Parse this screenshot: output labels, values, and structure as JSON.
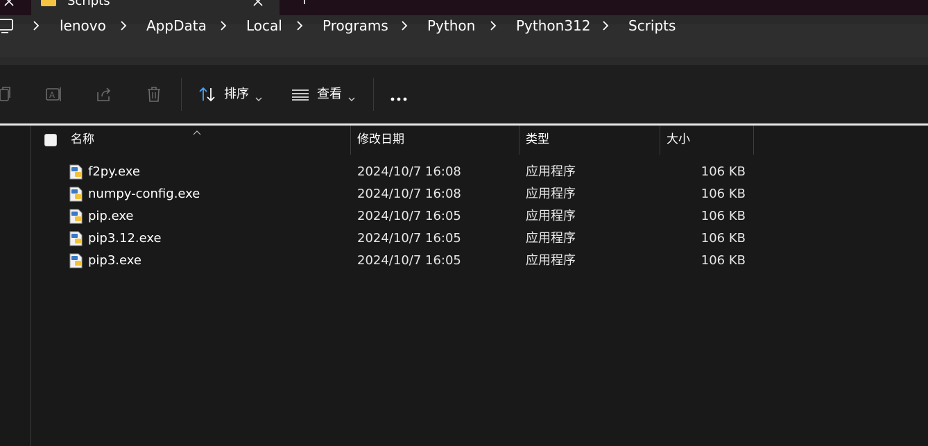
{
  "tabs": [
    {
      "title": "Scripts",
      "active": true
    }
  ],
  "breadcrumb": [
    "lenovo",
    "AppData",
    "Local",
    "Programs",
    "Python",
    "Python312",
    "Scripts"
  ],
  "toolbar": {
    "sort_label": "排序",
    "view_label": "查看"
  },
  "columns": [
    "名称",
    "修改日期",
    "类型",
    "大小"
  ],
  "files": [
    {
      "name": "f2py.exe",
      "modified": "2024/10/7 16:08",
      "type": "应用程序",
      "size": "106 KB"
    },
    {
      "name": "numpy-config.exe",
      "modified": "2024/10/7 16:08",
      "type": "应用程序",
      "size": "106 KB"
    },
    {
      "name": "pip.exe",
      "modified": "2024/10/7 16:05",
      "type": "应用程序",
      "size": "106 KB"
    },
    {
      "name": "pip3.12.exe",
      "modified": "2024/10/7 16:05",
      "type": "应用程序",
      "size": "106 KB"
    },
    {
      "name": "pip3.exe",
      "modified": "2024/10/7 16:05",
      "type": "应用程序",
      "size": "106 KB"
    }
  ],
  "icons": {
    "tab": "folder-icon",
    "address_root": "computer-icon",
    "toolbar": [
      "copy-icon",
      "rename-icon",
      "share-icon",
      "delete-icon",
      "sort-icon",
      "view-icon",
      "more-icon"
    ],
    "file": "python-exe-icon"
  },
  "colors": {
    "window_bg": "#191919",
    "titlebar_bg": "#1f0f18",
    "address_bg": "#2e2e2e",
    "toolbar_bg": "#1e1e1e",
    "accent_sort": "#4aa3ff"
  }
}
